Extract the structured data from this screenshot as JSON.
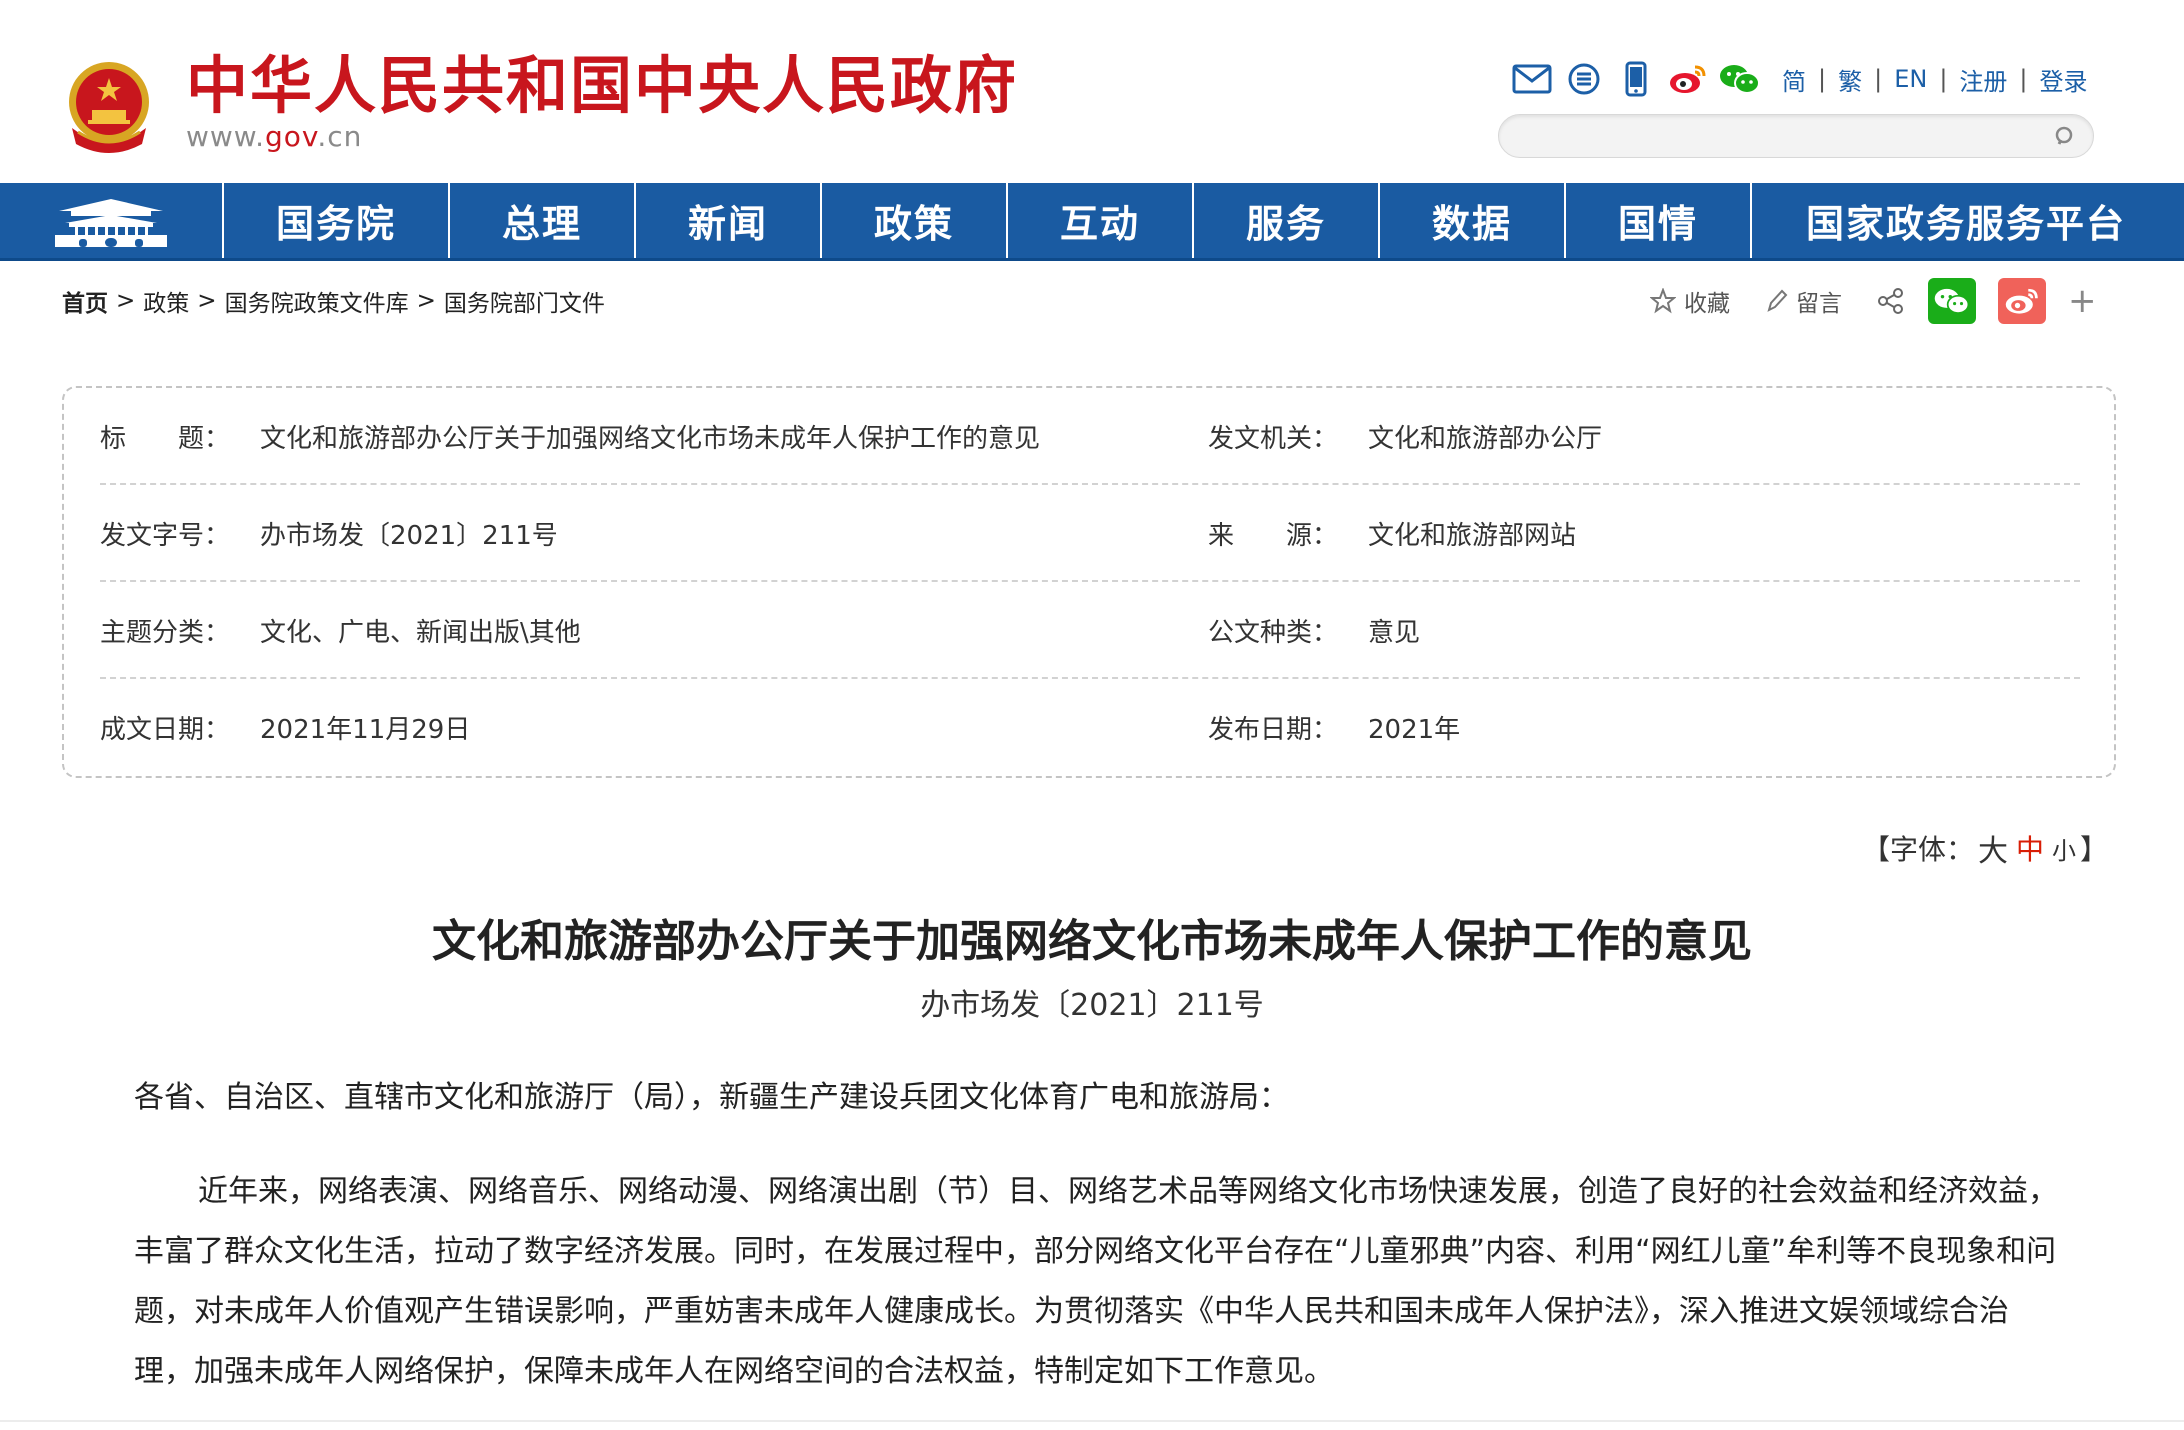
{
  "header": {
    "title": "中华人民共和国中央人民政府",
    "url_prefix": "www.",
    "url_highlight": "gov",
    "url_suffix": ".cn",
    "tool_icons": [
      "mail-icon",
      "rss-icon",
      "mobile-icon",
      "weibo-icon",
      "wechat-icon"
    ],
    "lang_links": [
      "简",
      "繁",
      "EN",
      "注册",
      "登录"
    ],
    "search": {
      "value": "",
      "placeholder": ""
    }
  },
  "nav": {
    "items": [
      "国务院",
      "总理",
      "新闻",
      "政策",
      "互动",
      "服务",
      "数据",
      "国情",
      "国家政务服务平台"
    ]
  },
  "breadcrumb": [
    "首页",
    "政策",
    "国务院政策文件库",
    "国务院部门文件"
  ],
  "breadcrumb_sep": ">",
  "share": {
    "favorite": "收藏",
    "comment": "留言",
    "plus": "+"
  },
  "info": {
    "rows": [
      {
        "label": "标　　题：",
        "value": "文化和旅游部办公厅关于加强网络文化市场未成年人保护工作的意见",
        "label2": "发文机关：",
        "value2": "文化和旅游部办公厅"
      },
      {
        "label": "发文字号：",
        "value": "办市场发〔2021〕211号",
        "label2": "来　　源：",
        "value2": "文化和旅游部网站"
      },
      {
        "label": "主题分类：",
        "value": "文化、广电、新闻出版\\其他",
        "label2": "公文种类：",
        "value2": "意见"
      },
      {
        "label": "成文日期：",
        "value": "2021年11月29日",
        "label2": "发布日期：",
        "value2": "2021年"
      }
    ]
  },
  "fontsize": {
    "open": "【字体：",
    "big": "大",
    "mid": "中",
    "small": "小",
    "close": "】"
  },
  "article": {
    "title": "文化和旅游部办公厅关于加强网络文化市场未成年人保护工作的意见",
    "doc_number": "办市场发〔2021〕211号",
    "salutation": "各省、自治区、直辖市文化和旅游厅（局），新疆生产建设兵团文化体育广电和旅游局：",
    "paragraph": "近年来，网络表演、网络音乐、网络动漫、网络演出剧（节）目、网络艺术品等网络文化市场快速发展，创造了良好的社会效益和经济效益，丰富了群众文化生活，拉动了数字经济发展。同时，在发展过程中，部分网络文化平台存在“儿童邪典”内容、利用“网红儿童”牟利等不良现象和问题，对未成年人价值观产生错误影响，严重妨害未成年人健康成长。为贯彻落实《中华人民共和国未成年人保护法》，深入推进文娱领域综合治理，加强未成年人网络保护，保障未成年人在网络空间的合法权益，特制定如下工作意见。"
  },
  "colors": {
    "brand_red": "#c8161d",
    "nav_blue": "#1a5ba2",
    "link_blue": "#1c5fa7",
    "wechat_green": "#1aad19",
    "weibo_red": "#e6162d"
  }
}
